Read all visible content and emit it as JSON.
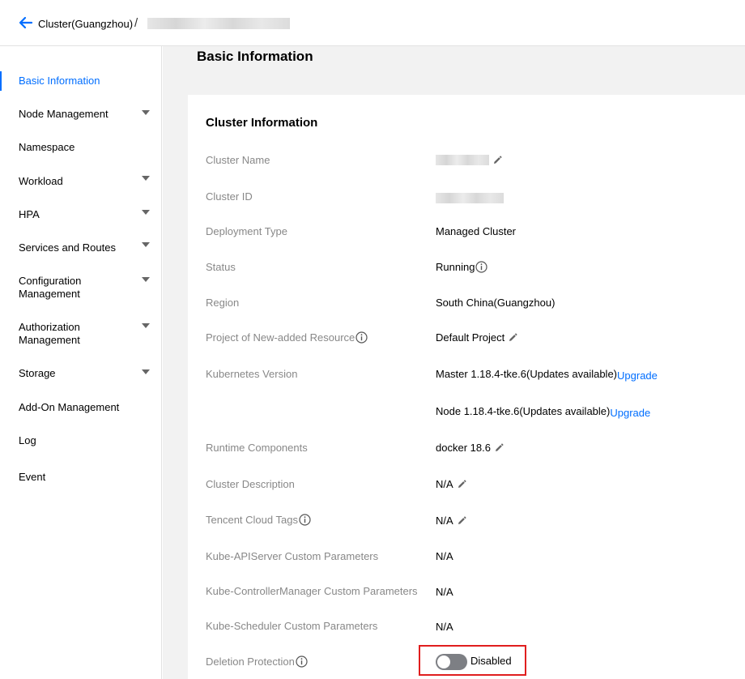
{
  "breadcrumb": {
    "root": "Cluster(Guangzhou)",
    "separator": "/"
  },
  "sidebar": {
    "items": [
      {
        "label": "Basic Information"
      },
      {
        "label": "Node Management"
      },
      {
        "label": "Namespace"
      },
      {
        "label": "Workload"
      },
      {
        "label": "HPA"
      },
      {
        "label": "Services and Routes"
      },
      {
        "label": "Configuration Management"
      },
      {
        "label": "Authorization Management"
      },
      {
        "label": "Storage"
      },
      {
        "label": "Add-On Management"
      },
      {
        "label": "Log"
      },
      {
        "label": "Event"
      }
    ]
  },
  "page": {
    "title": "Basic Information"
  },
  "cluster_info": {
    "title": "Cluster Information",
    "labels": {
      "cluster_name": "Cluster Name",
      "cluster_id": "Cluster ID",
      "deployment_type": "Deployment Type",
      "status": "Status",
      "region": "Region",
      "project": "Project of New-added Resource",
      "k8s_version": "Kubernetes Version",
      "runtime": "Runtime Components",
      "description": "Cluster Description",
      "tags": "Tencent Cloud Tags",
      "apiserver": "Kube-APIServer Custom Parameters",
      "controller": "Kube-ControllerManager Custom Parameters",
      "scheduler": "Kube-Scheduler Custom Parameters",
      "deletion_protection": "Deletion Protection"
    },
    "values": {
      "deployment_type": "Managed Cluster",
      "status": "Running",
      "region": "South China(Guangzhou)",
      "project": "Default Project",
      "master_version": "Master 1.18.4-tke.6(Updates available)",
      "node_version": "Node 1.18.4-tke.6(Updates available)",
      "upgrade_link": "Upgrade",
      "runtime": "docker 18.6",
      "description": "N/A",
      "tags": "N/A",
      "apiserver": "N/A",
      "controller": "N/A",
      "scheduler": "N/A",
      "deletion_protection": "Disabled"
    }
  },
  "colors": {
    "accent": "#006eff",
    "toggle_off": "#7d7f84",
    "highlight_border": "#e01e1e"
  }
}
